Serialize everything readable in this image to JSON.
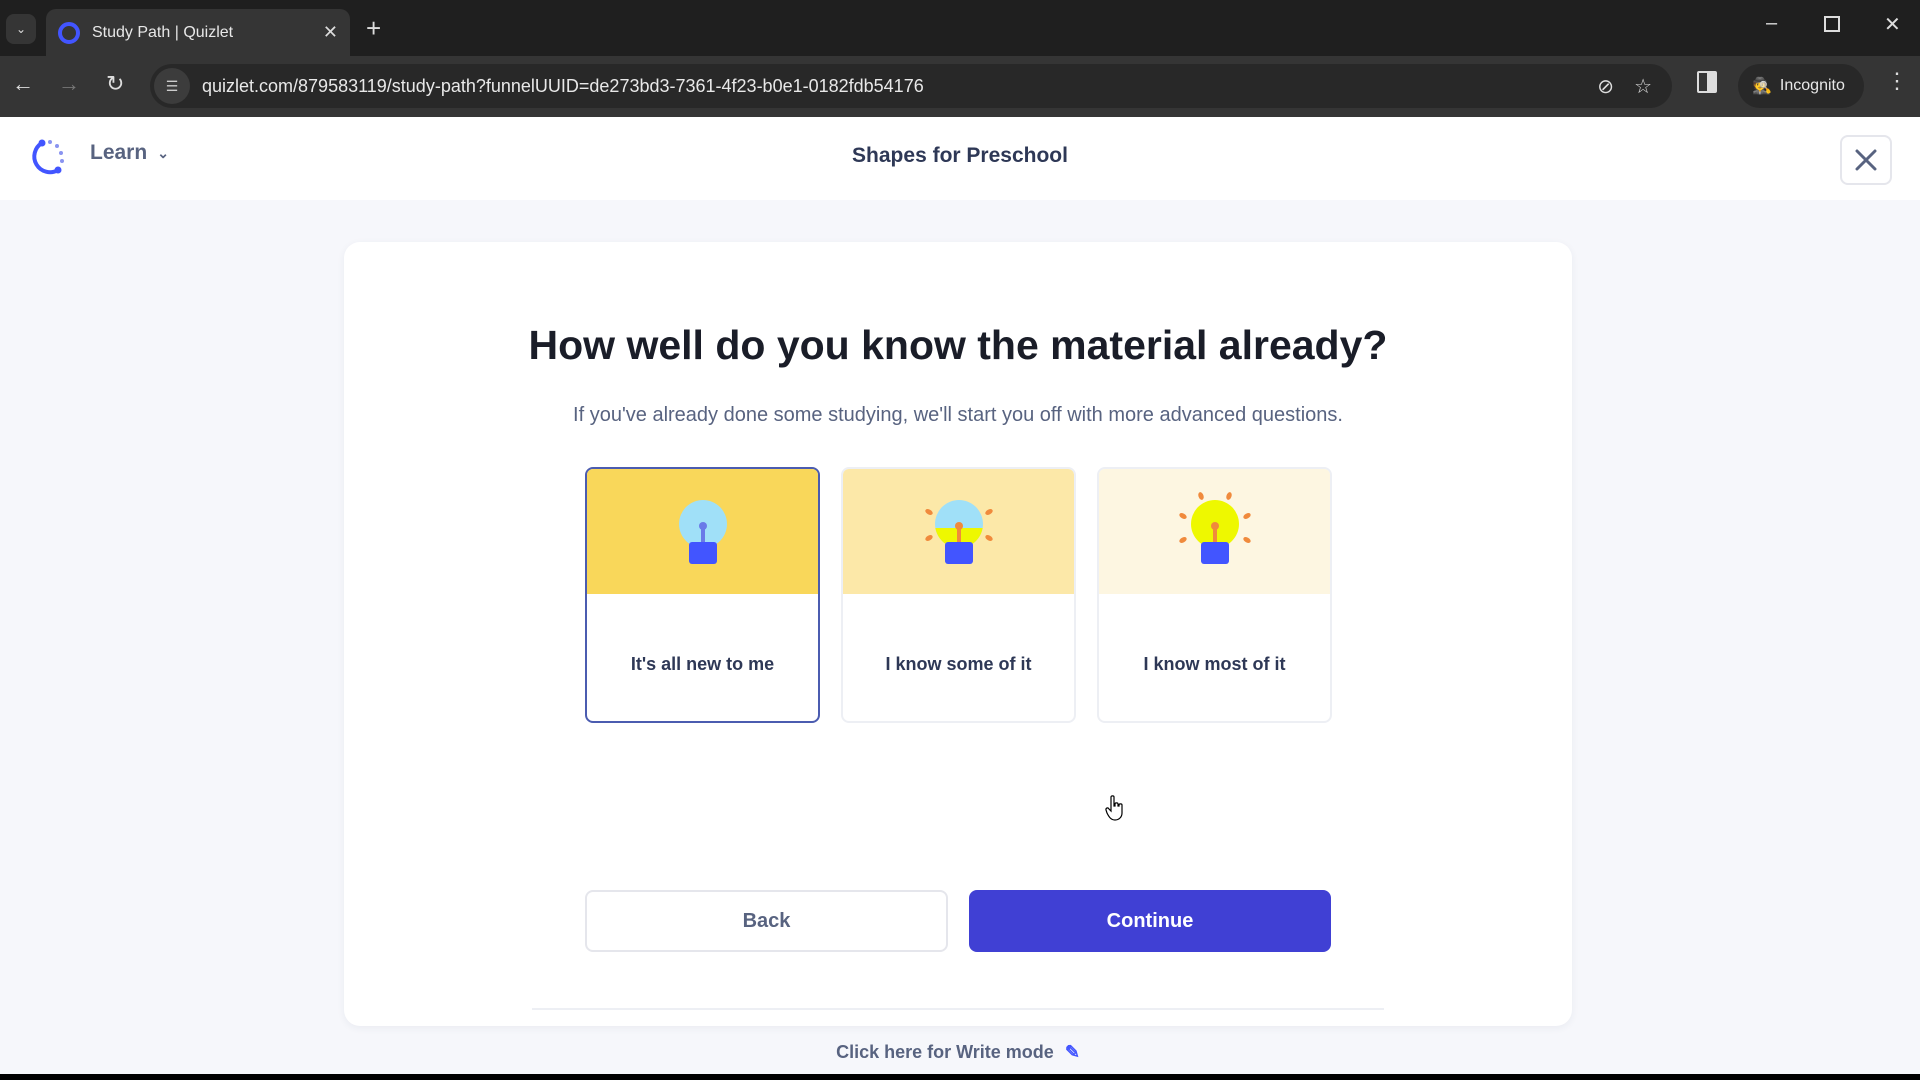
{
  "browser": {
    "tab_title": "Study Path | Quizlet",
    "url": "quizlet.com/879583119/study-path?funnelUUID=de273bd3-7361-4f23-b0e1-0182fdb54176",
    "incognito_label": "Incognito"
  },
  "header": {
    "mode_label": "Learn",
    "set_title": "Shapes for Preschool"
  },
  "main": {
    "heading": "How well do you know the material already?",
    "subtitle": "If you've already done some studying, we'll start you off with more advanced questions.",
    "options": [
      {
        "label": "It's all new to me",
        "selected": true,
        "bg": "#f9d75a",
        "bulb_fill": "#a0e0f8",
        "rays": 0
      },
      {
        "label": "I know some of it",
        "selected": false,
        "bg": "#fce8a8",
        "bulb_fill": "half",
        "rays": 4
      },
      {
        "label": "I know most of it",
        "selected": false,
        "bg": "#fdf6e1",
        "bulb_fill": "#eef800",
        "rays": 6
      }
    ],
    "back_label": "Back",
    "continue_label": "Continue",
    "write_mode_link": "Click here for Write mode"
  },
  "colors": {
    "accent": "#4040d4",
    "brand": "#4255ff",
    "text_primary": "#1a1d28",
    "text_secondary": "#586380"
  }
}
